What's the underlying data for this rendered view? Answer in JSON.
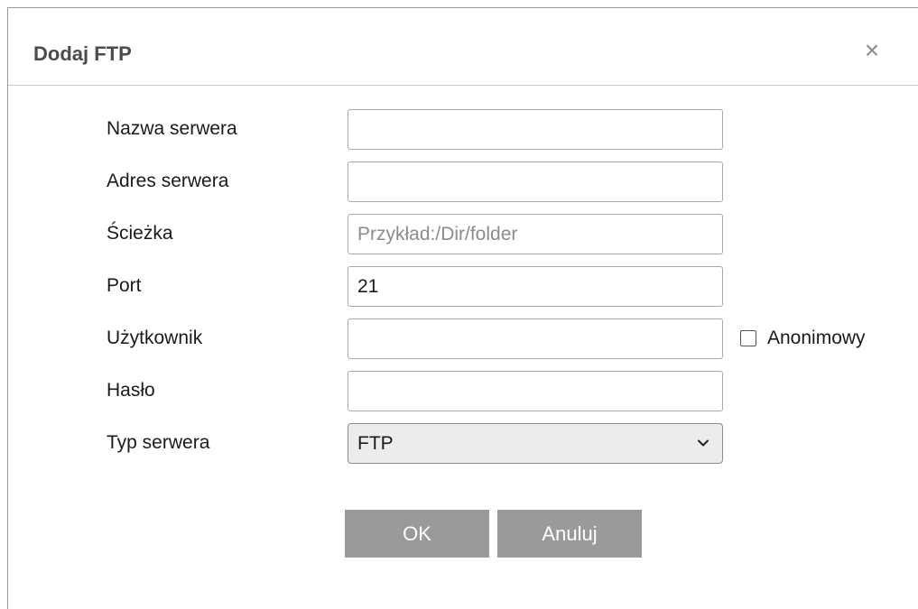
{
  "dialog": {
    "title": "Dodaj FTP",
    "close_icon": "close-icon",
    "close_glyph": "×"
  },
  "form": {
    "server_name": {
      "label": "Nazwa serwera",
      "value": "",
      "placeholder": ""
    },
    "server_address": {
      "label": "Adres serwera",
      "value": "",
      "placeholder": ""
    },
    "path": {
      "label": "Ścieżka",
      "value": "",
      "placeholder": "Przykład:/Dir/folder"
    },
    "port": {
      "label": "Port",
      "value": "21",
      "placeholder": ""
    },
    "user": {
      "label": "Użytkownik",
      "value": "",
      "placeholder": ""
    },
    "anonymous": {
      "label": "Anonimowy",
      "checked": false
    },
    "password": {
      "label": "Hasło",
      "value": "",
      "placeholder": ""
    },
    "server_type": {
      "label": "Typ serwera",
      "value": "FTP",
      "icon": "chevron-down-icon"
    }
  },
  "buttons": {
    "ok": "OK",
    "cancel": "Anuluj"
  },
  "colors": {
    "button_bg": "#9a9a9a",
    "title_text": "#4b4b4b",
    "field_border": "#a9a9a9"
  }
}
